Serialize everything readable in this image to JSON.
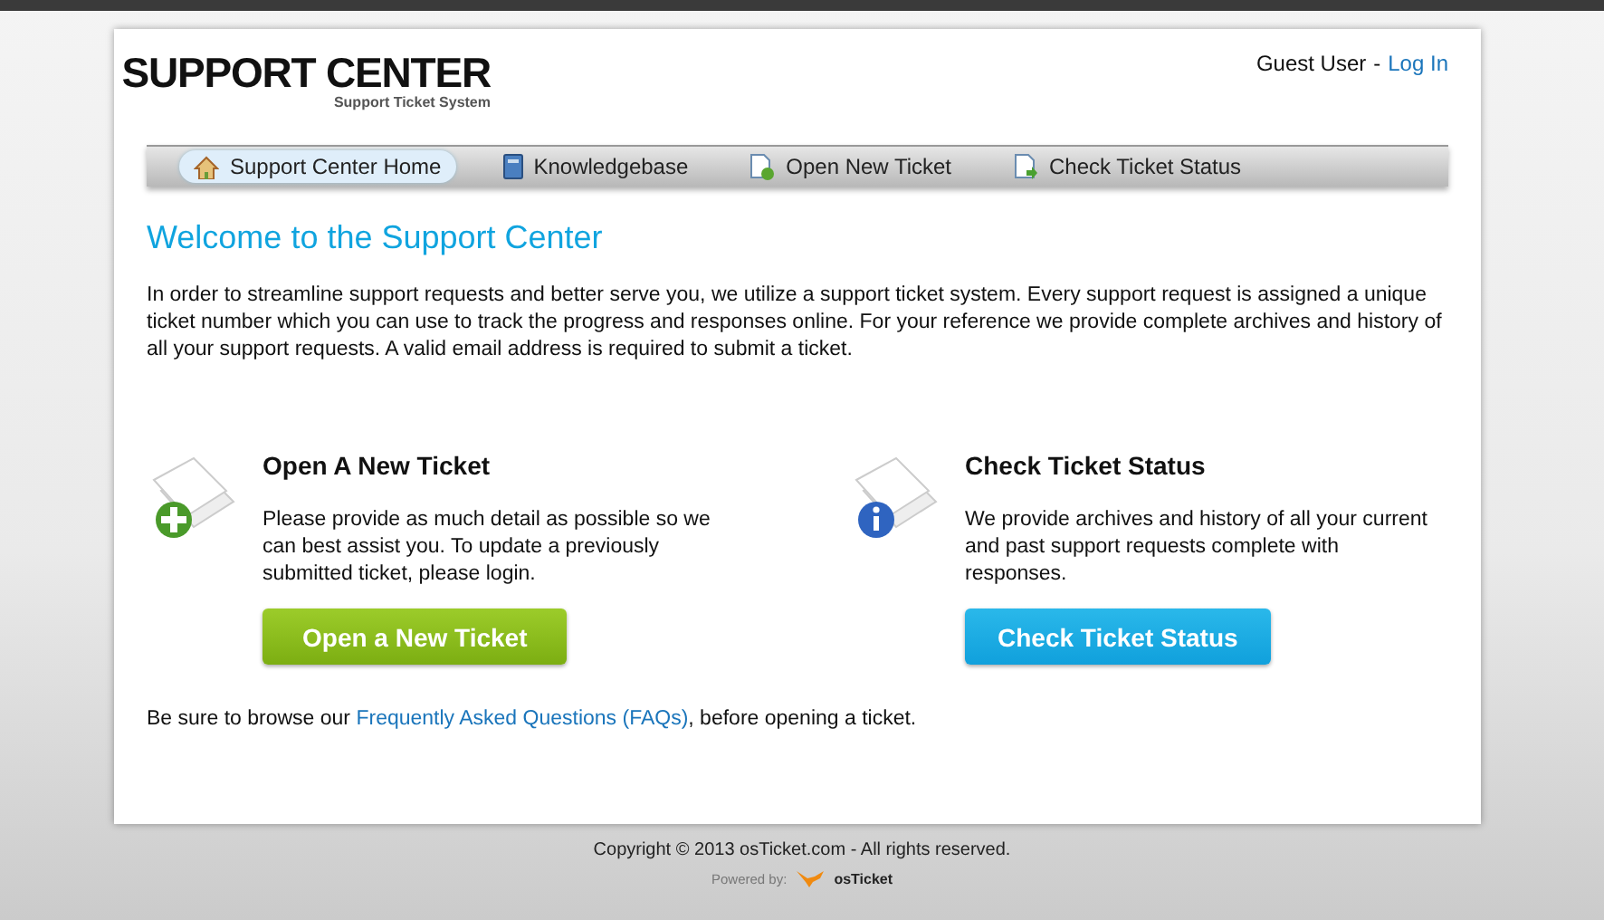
{
  "header": {
    "logo_title": "SUPPORT CENTER",
    "logo_subtitle": "Support Ticket System",
    "user": "Guest User",
    "separator": "-",
    "login_link": "Log In"
  },
  "nav": [
    {
      "label": "Support Center Home",
      "kind": "home",
      "selected": true
    },
    {
      "label": "Knowledgebase",
      "kind": "book",
      "selected": false
    },
    {
      "label": "Open New Ticket",
      "kind": "new",
      "selected": false
    },
    {
      "label": "Check Ticket Status",
      "kind": "status",
      "selected": false
    }
  ],
  "welcome": {
    "title": "Welcome to the Support Center",
    "text": "In order to streamline support requests and better serve you, we utilize a support ticket system. Every support request is assigned a unique ticket number which you can use to track the progress and responses online. For your reference we provide complete archives and history of all your support requests. A valid email address is required to submit a ticket."
  },
  "actions": [
    {
      "kind": "new",
      "title": "Open A New Ticket",
      "text": "Please provide as much detail as possible so we can best assist you. To update a previously submitted ticket, please login.",
      "button": "Open a New Ticket"
    },
    {
      "kind": "status",
      "title": "Check Ticket Status",
      "text": "We provide archives and history of all your current and past support requests complete with responses.",
      "button": "Check Ticket Status"
    }
  ],
  "faq_note": {
    "before": "Be sure to browse our",
    "link": "Frequently Asked Questions (FAQs)",
    "after": ", before opening a ticket."
  },
  "footer": {
    "copyright": "Copyright © 2013 osTicket.com - All rights reserved.",
    "powered_by": "Powered by:",
    "brand": "osTicket"
  }
}
